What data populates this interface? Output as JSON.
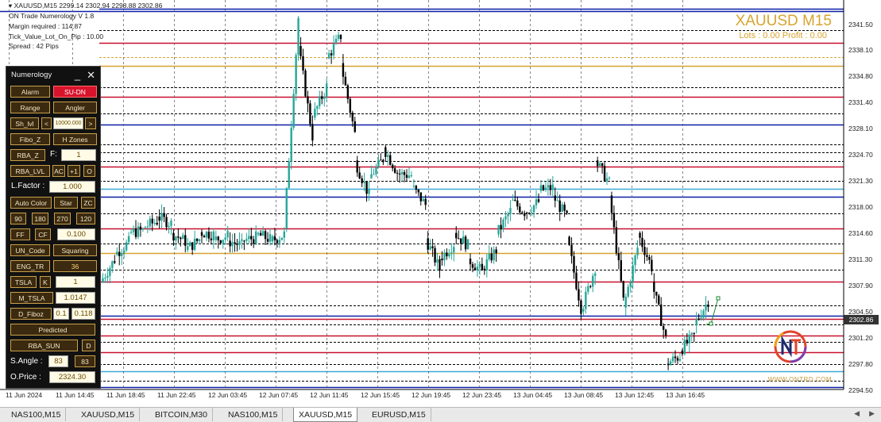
{
  "window": {
    "title_line": "XAUUSD,M15  2299.14 2302.94 2298.88 2302.86"
  },
  "info_lines": [
    "ON Trade Numerology V 1.8",
    "Margin required : 114.87",
    "Tick_Value_Lot_On_Pip : 10.00",
    "Spread : 42  Pips"
  ],
  "symbol": {
    "title": "XAUUSD M15",
    "sub": "Lots : 0.00 Profit : 0.00"
  },
  "watermark": "WWW.ONTRD.COM",
  "panel": {
    "title": "Numerology",
    "minimize": "_",
    "close": "✕",
    "alarm": "Alarm",
    "su_dn": "SU-DN",
    "range": "Range",
    "angler": "Angler",
    "sh_lvl": "Sh_lvl",
    "lt": "<",
    "sh_value": "10000.000",
    "gt": ">",
    "fibo_z": "Fibo_Z",
    "h_zones": "H Zones",
    "rba_z": "RBA_Z",
    "f_label": "F:",
    "f_value": "1",
    "rba_lvl": "RBA_LVL",
    "ac": "AC",
    "plus1": "+1",
    "o": "O",
    "lfactor_label": "L.Factor :",
    "lfactor_value": "1.000",
    "auto_color": "Auto Color",
    "star": "Star",
    "zc": "ZC",
    "n90": "90",
    "n180": "180",
    "n270": "270",
    "n120": "120",
    "ff": "FF",
    "cf": "CF",
    "cf_value": "0.100",
    "un_code": "UN_Code",
    "squaring": "Squaring",
    "eng_tr": "ENG_TR",
    "eng_value": "36",
    "tsla": "TSLA",
    "k": "K",
    "k_value": "1",
    "m_tsla": "M_TSLA",
    "m_tsla_value": "1.0147",
    "d_fiboz": "D_Fiboz",
    "d_v1": "0.1",
    "d_v2": "0.118",
    "predicted": "Predicted",
    "rba_sun": "RBA_SUN",
    "d": "D",
    "sangle_label": "S.Angle :",
    "sangle_v1": "83",
    "sangle_v2": "83",
    "oprice_label": "O.Price :",
    "oprice_value": "2324.30"
  },
  "price_axis": [
    "2341.50",
    "2338.10",
    "2334.80",
    "2331.40",
    "2328.10",
    "2324.70",
    "2321.30",
    "2318.00",
    "2314.60",
    "2311.30",
    "2307.90",
    "2304.50",
    "2301.20",
    "2297.80",
    "2294.50"
  ],
  "current_price": "2302.86",
  "time_axis": [
    "11 Jun 2024",
    "11 Jun 14:45",
    "11 Jun 18:45",
    "11 Jun 22:45",
    "12 Jun 03:45",
    "12 Jun 07:45",
    "12 Jun 11:45",
    "12 Jun 15:45",
    "12 Jun 19:45",
    "12 Jun 23:45",
    "13 Jun 04:45",
    "13 Jun 08:45",
    "13 Jun 12:45",
    "13 Jun 16:45"
  ],
  "tabs": [
    "NAS100,M15",
    "XAUUSD,M15",
    "BITCOIN,M30",
    "NAS100,M15",
    "XAUUSD,M15",
    "EURUSD,M15"
  ],
  "active_tab": 4,
  "colors": {
    "bull": "#26a69a",
    "bear": "#000000",
    "blue": "#0b1fa8",
    "red": "#c8102e",
    "gold": "#d7a430",
    "cyan": "#3fa9d6"
  },
  "chart_data": {
    "type": "candlestick",
    "symbol": "XAUUSD",
    "timeframe": "M15",
    "ylim": [
      2293.5,
      2343.5
    ],
    "ohlc_last": {
      "open": 2299.14,
      "high": 2302.94,
      "low": 2298.88,
      "close": 2302.86
    },
    "levels": [
      {
        "price": 2342.4,
        "style": "solid",
        "color": "blue"
      },
      {
        "price": 2339.6,
        "style": "dashed",
        "color": "black"
      },
      {
        "price": 2338.0,
        "style": "solid",
        "color": "red"
      },
      {
        "price": 2336.2,
        "style": "dashed",
        "color": "gold"
      },
      {
        "price": 2335.0,
        "style": "solid",
        "color": "gold"
      },
      {
        "price": 2332.3,
        "style": "dashed",
        "color": "black"
      },
      {
        "price": 2331.1,
        "style": "solid",
        "color": "red"
      },
      {
        "price": 2328.9,
        "style": "dashed",
        "color": "black"
      },
      {
        "price": 2327.5,
        "style": "solid",
        "color": "blue"
      },
      {
        "price": 2325.0,
        "style": "dashed",
        "color": "black"
      },
      {
        "price": 2323.9,
        "style": "dashed",
        "color": "black"
      },
      {
        "price": 2322.8,
        "style": "dashed",
        "color": "black"
      },
      {
        "price": 2322.1,
        "style": "solid",
        "color": "red"
      },
      {
        "price": 2320.3,
        "style": "dashed",
        "color": "black"
      },
      {
        "price": 2319.3,
        "style": "solid",
        "color": "cyan"
      },
      {
        "price": 2318.2,
        "style": "solid",
        "color": "blue"
      },
      {
        "price": 2316.1,
        "style": "dashed",
        "color": "black"
      },
      {
        "price": 2314.2,
        "style": "solid",
        "color": "red"
      },
      {
        "price": 2312.2,
        "style": "dashed",
        "color": "black"
      },
      {
        "price": 2311.0,
        "style": "solid",
        "color": "gold"
      },
      {
        "price": 2308.9,
        "style": "dashed",
        "color": "black"
      },
      {
        "price": 2307.3,
        "style": "solid",
        "color": "red"
      },
      {
        "price": 2304.3,
        "style": "dashed",
        "color": "black"
      },
      {
        "price": 2303.0,
        "style": "solid",
        "color": "blue"
      },
      {
        "price": 2302.6,
        "style": "solid",
        "color": "red"
      },
      {
        "price": 2301.8,
        "style": "dashed",
        "color": "black"
      },
      {
        "price": 2300.4,
        "style": "solid",
        "color": "red"
      },
      {
        "price": 2299.6,
        "style": "dashed",
        "color": "black"
      },
      {
        "price": 2298.3,
        "style": "solid",
        "color": "red"
      },
      {
        "price": 2296.8,
        "style": "dashed",
        "color": "black"
      },
      {
        "price": 2295.8,
        "style": "solid",
        "color": "cyan"
      },
      {
        "price": 2294.6,
        "style": "dashed",
        "color": "black"
      },
      {
        "price": 2293.8,
        "style": "solid",
        "color": "blue"
      }
    ],
    "close_path": [
      [
        2307.3,
        2310.2
      ],
      [
        2310.8,
        2312.4
      ],
      [
        2313.6,
        2313.9
      ],
      [
        2314.3,
        2315.1
      ],
      [
        2315.7,
        2314.8
      ],
      [
        2313.6,
        2312.5
      ],
      [
        2311.4,
        2312.8
      ],
      [
        2313.7,
        2313.4
      ],
      [
        2312.7,
        2313.2
      ],
      [
        2312.6,
        2312.0
      ],
      [
        2312.6,
        2313.0
      ],
      [
        2313.4,
        2312.8
      ],
      [
        2312.5,
        2313.4
      ],
      [
        2314.2,
        2341.2
      ],
      [
        2337.6,
        2326.0
      ],
      [
        2328.4,
        2332.4
      ],
      [
        2336.0,
        2338.9
      ],
      [
        2335.4,
        2326.3
      ],
      [
        2322.9,
        2318.4
      ],
      [
        2320.6,
        2323.1
      ],
      [
        2324.6,
        2321.4
      ],
      [
        2321.2,
        2321.0
      ],
      [
        2319.6,
        2317.2
      ],
      [
        2312.9,
        2308.9
      ],
      [
        2310.3,
        2312.2
      ],
      [
        2313.6,
        2312.0
      ],
      [
        2310.3,
        2308.6
      ],
      [
        2309.0,
        2311.4
      ],
      [
        2313.4,
        2316.4
      ],
      [
        2317.8,
        2316.3
      ],
      [
        2316.2,
        2317.6
      ],
      [
        2319.0,
        2319.4
      ],
      [
        2318.4,
        2315.5
      ],
      [
        2313.1,
        2304.0
      ],
      [
        2303.5,
        2309.2
      ],
      [
        2322.9,
        2320.0
      ],
      [
        2318.4,
        2304.9
      ],
      [
        2304.0,
        2311.7
      ],
      [
        2313.6,
        2309.2
      ],
      [
        2307.3,
        2300.0
      ],
      [
        2296.8,
        2297.8
      ],
      [
        2298.5,
        2300.4
      ],
      [
        2301.8,
        2304.9
      ]
    ]
  }
}
